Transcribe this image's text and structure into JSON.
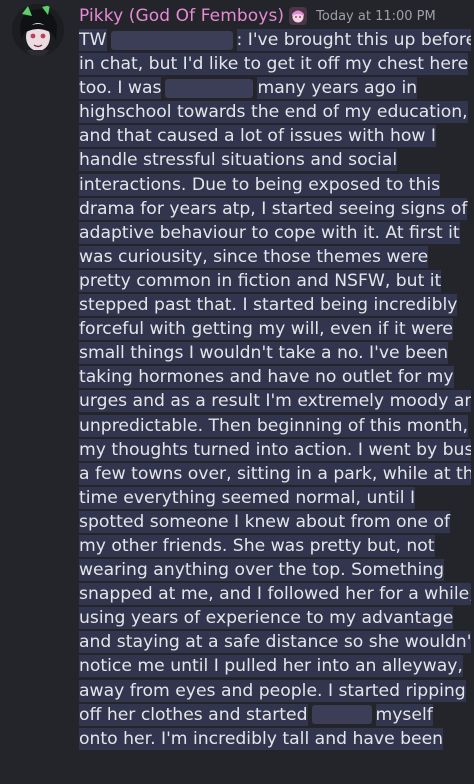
{
  "message": {
    "username": "Pikky (God Of Femboys)",
    "timestamp": "Today at 11:00 PM",
    "role_icon": "pink-character-emoji",
    "avatar_icon": "anime-avatar-green-hair",
    "lines": [
      [
        "TW",
        null,
        ": I've brought this up before"
      ],
      [
        "in chat, but I'd like to get it off my chest here"
      ],
      [
        "too. I was",
        null,
        "many years ago in"
      ],
      [
        "highschool towards the end of my education,"
      ],
      [
        "and that caused a lot of issues with how I"
      ],
      [
        "handle stressful situations and social"
      ],
      [
        "interactions. Due to being exposed to this"
      ],
      [
        "drama for years atp, I started seeing signs of"
      ],
      [
        "adaptive behaviour to cope with it. At first it"
      ],
      [
        "was curiousity, since those themes were"
      ],
      [
        "pretty common in fiction and NSFW, but it"
      ],
      [
        "stepped past that. I started being incredibly"
      ],
      [
        "forceful with getting my will, even if it were"
      ],
      [
        "small things I wouldn't take a no. I've been"
      ],
      [
        "taking hormones and have no outlet for my"
      ],
      [
        "urges and as a result I'm extremely moody and"
      ],
      [
        "unpredictable. Then beginning of this month,"
      ],
      [
        "my thoughts turned into action. I went by bus"
      ],
      [
        "a few towns over, sitting in a park, while at the"
      ],
      [
        "time everything seemed normal, until I"
      ],
      [
        "spotted someone I knew about from one of"
      ],
      [
        "my other friends. She was pretty but, not"
      ],
      [
        "wearing anything over the top. Something"
      ],
      [
        "snapped at me, and I followed her for a while,"
      ],
      [
        "using years of experience to my advantage"
      ],
      [
        "and staying at a safe distance so she wouldn't"
      ],
      [
        "notice me until I pulled her into an alleyway,"
      ],
      [
        "away from eyes and people. I started ripping"
      ],
      [
        "off her clothes and started",
        null,
        "myself"
      ],
      [
        "onto her. I'm incredibly tall and have been"
      ]
    ]
  }
}
